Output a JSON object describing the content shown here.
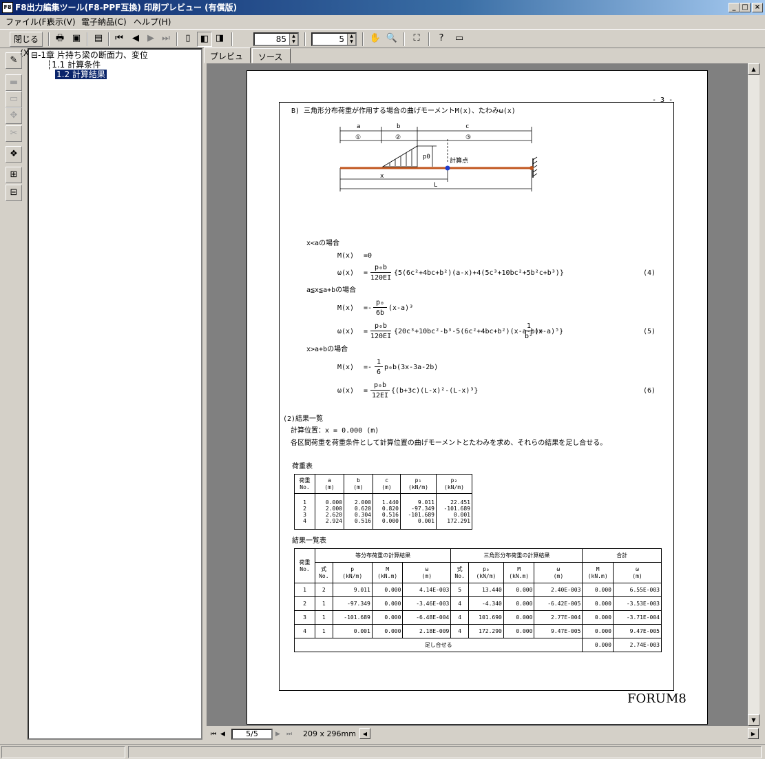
{
  "window": {
    "title": "F8出力編集ツール(F8-PPF互換) 印刷プレビュー (有償版)",
    "app_icon": "page-icon",
    "controls": {
      "minimize": "_",
      "maximize": "□",
      "close": "×"
    }
  },
  "menu": [
    "ファイル(F)",
    "表示(V)",
    "電子納品(C)",
    "ヘルプ(H)"
  ],
  "toolbar": {
    "close_label": "閉じる(X)",
    "zoom": "85",
    "pages": "5"
  },
  "tree": {
    "root": "1章 片持ち梁の断面力、変位",
    "items": [
      "1.1 計算条件",
      "1.2 計算結果"
    ]
  },
  "tabs": [
    "プレビュー",
    "ソース"
  ],
  "page": {
    "number": "- 3 -",
    "heading": "B) 三角形分布荷重が作用する場合の曲げモーメントM(x)、たわみω(x)",
    "diagram": {
      "labels": [
        "a",
        "b",
        "c",
        "①",
        "②",
        "③",
        "p0",
        "計算点",
        "x",
        "L"
      ]
    },
    "formulas": [
      {
        "cond": "x<aの場合"
      },
      {
        "lhs": "M(x)",
        "rhs": "=0"
      },
      {
        "lhs": "ω(x)",
        "frac_n": "p₀b",
        "frac_d": "120EI",
        "rhs": "{5(6c²+4bc+b²)(a-x)+4(5c³+10bc²+5b²c+b³)}",
        "num": "(4)"
      },
      {
        "cond": "a≦x≦a+bの場合"
      },
      {
        "lhs": "M(x)",
        "frac_n": "p₀",
        "frac_d": "6b",
        "rhs": "(x-a)³",
        "sign": "=-"
      },
      {
        "lhs": "ω(x)",
        "frac_n": "p₀b",
        "frac_d": "120EI",
        "rhs": "{20c³+10bc²-b³-5(6c²+4bc+b²)(x-a-b)+",
        "frac2_n": "1",
        "frac2_d": "b²",
        "rhs2": "(x-a)⁵}",
        "num": "(5)"
      },
      {
        "cond": "x>a+bの場合"
      },
      {
        "lhs": "M(x)",
        "frac_n": "1",
        "frac_d": "6",
        "rhs": "p₀b(3x-3a-2b)",
        "sign": "=-"
      },
      {
        "lhs": "ω(x)",
        "frac_n": "p₀b",
        "frac_d": "12EI",
        "rhs": "{(b+3c)(L-x)²-(L-x)³}",
        "num": "(6)"
      }
    ],
    "results_title": "(2)結果一覧",
    "calc_pos": "計算位置：x = 0.000 (m)",
    "description": "各区間荷重を荷重条件として計算位置の曲げモーメントとたわみを求め、それらの結果を足し合せる。",
    "load_table_title": "荷重表",
    "load_table": {
      "headers": [
        [
          "荷重",
          "No."
        ],
        [
          "a",
          "(m)"
        ],
        [
          "b",
          "(m)"
        ],
        [
          "c",
          "(m)"
        ],
        [
          "p₁",
          "(kN/m)"
        ],
        [
          "p₂",
          "(kN/m)"
        ]
      ],
      "cols": [
        [
          "1",
          "2",
          "3",
          "4"
        ],
        [
          "0.000",
          "2.000",
          "2.620",
          "2.924"
        ],
        [
          "2.000",
          "0.620",
          "0.304",
          "0.516"
        ],
        [
          "1.440",
          "0.820",
          "0.516",
          "0.000"
        ],
        [
          "9.011",
          "-97.349",
          "-101.689",
          "0.001"
        ],
        [
          "22.451",
          "-101.689",
          "0.001",
          "172.291"
        ]
      ]
    },
    "result_table_title": "結果一覧表",
    "result_table": {
      "group_headers": [
        "荷重",
        "等分布荷重の計算結果",
        "三角形分布荷重の計算結果",
        "合計"
      ],
      "no_sub": "No.",
      "sub_headers": [
        [
          "式",
          "No."
        ],
        [
          "p",
          "(kN/m)"
        ],
        [
          "M",
          "(kN.m)"
        ],
        [
          "ω",
          "(m)"
        ],
        [
          "式",
          "No."
        ],
        [
          "p₀",
          "(kN/m)"
        ],
        [
          "M",
          "(kN.m)"
        ],
        [
          "ω",
          "(m)"
        ],
        [
          "M",
          "(kN.m)"
        ],
        [
          "ω",
          "(m)"
        ]
      ],
      "rows": [
        [
          "1",
          "2",
          "9.011",
          "0.000",
          "4.14E-003",
          "5",
          "13.440",
          "0.000",
          "2.40E-003",
          "0.000",
          "6.55E-003"
        ],
        [
          "2",
          "1",
          "-97.349",
          "0.000",
          "-3.46E-003",
          "4",
          "-4.340",
          "0.000",
          "-6.42E-005",
          "0.000",
          "-3.53E-003"
        ],
        [
          "3",
          "1",
          "-101.689",
          "0.000",
          "-6.48E-004",
          "4",
          "101.690",
          "0.000",
          "2.77E-004",
          "0.000",
          "-3.71E-004"
        ],
        [
          "4",
          "1",
          "0.001",
          "0.000",
          "2.18E-009",
          "4",
          "172.290",
          "0.000",
          "9.47E-005",
          "0.000",
          "9.47E-005"
        ]
      ],
      "total_label": "足し合せる",
      "total_M": "0.000",
      "total_w": "2.74E-003"
    },
    "brand": "FORUM8"
  },
  "footer": {
    "page_indicator": "5/5",
    "paper_size": "209 x 296mm"
  }
}
